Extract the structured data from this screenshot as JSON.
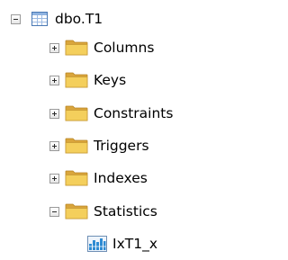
{
  "tree": {
    "table": {
      "label": "dbo.T1",
      "expanded": true,
      "icon": "table-icon"
    },
    "folders": [
      {
        "key": "columns",
        "label": "Columns",
        "expanded": false,
        "icon": "folder-icon"
      },
      {
        "key": "keys",
        "label": "Keys",
        "expanded": false,
        "icon": "folder-icon"
      },
      {
        "key": "constraints",
        "label": "Constraints",
        "expanded": false,
        "icon": "folder-icon"
      },
      {
        "key": "triggers",
        "label": "Triggers",
        "expanded": false,
        "icon": "folder-icon"
      },
      {
        "key": "indexes",
        "label": "Indexes",
        "expanded": false,
        "icon": "folder-icon"
      },
      {
        "key": "statistics",
        "label": "Statistics",
        "expanded": true,
        "icon": "folder-icon"
      }
    ],
    "statistics_children": [
      {
        "label": "IxT1_x",
        "icon": "statistics-icon"
      }
    ]
  },
  "colors": {
    "folder_back": "#d9a53c",
    "folder_front": "#f4cf5c",
    "stats_bar": "#2e8bd3"
  }
}
